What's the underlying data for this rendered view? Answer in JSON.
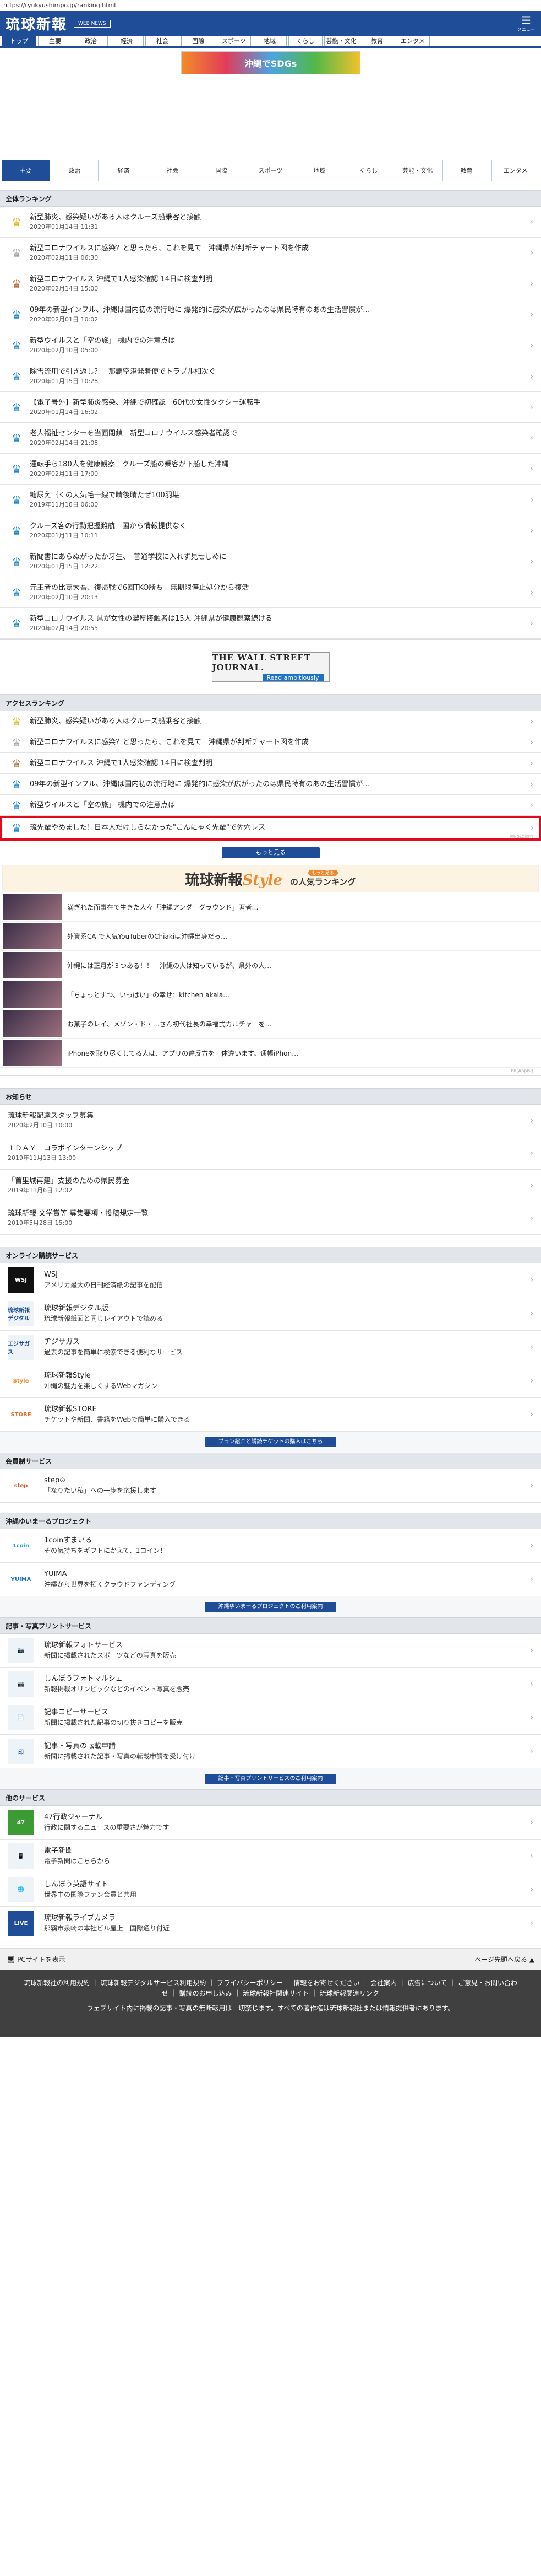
{
  "url": "https://ryukyushimpo.jp/ranking.html",
  "site": {
    "logo": "琉球新報",
    "web_news": "WEB NEWS",
    "menu": "メニュー"
  },
  "top_nav": [
    "トップ",
    "主要",
    "政治",
    "経済",
    "社会",
    "国際",
    "スポーツ",
    "地域",
    "くらし",
    "芸能・文化",
    "教育",
    "エンタメ"
  ],
  "banner_text": "沖縄でSDGs",
  "tabs": [
    "主要",
    "政治",
    "経済",
    "社会",
    "国際",
    "スポーツ",
    "地域",
    "くらし",
    "芸能・文化",
    "教育",
    "エンタメ"
  ],
  "overall": {
    "heading": "全体ランキング",
    "items": [
      {
        "title": "新型肺炎、感染疑いがある人はクルーズ船乗客と接触",
        "date": "2020年01月14日 11:31",
        "crown": "g"
      },
      {
        "title": "新型コロナウイルスに感染？と思ったら、これを見て　沖縄県が判断チャート図を作成",
        "date": "2020年02月11日 06:30",
        "crown": "s"
      },
      {
        "title": "新型コロナウイルス 沖縄で1人感染確認 14日に検査判明",
        "date": "2020年02月14日 15:00",
        "crown": "bz"
      },
      {
        "title": "09年の新型インフル、沖縄は国内初の流行地に 爆発的に感染が広がったのは県民特有のあの生活習慣が…",
        "date": "2020年02月01日 10:02",
        "crown": "bl"
      },
      {
        "title": "新型ウイルスと「空の旅」 機内での注意点は",
        "date": "2020年02月10日 05:00",
        "crown": "bl"
      },
      {
        "title": "除雪流用で引き返し？　那覇空港発着便でトラブル相次ぐ",
        "date": "2020年01月15日 10:28",
        "crown": "bl"
      },
      {
        "title": "【電子号外】新型肺炎感染、沖縄で初確認　60代の女性タクシー運転手",
        "date": "2020年01月14日 16:02",
        "crown": "bl"
      },
      {
        "title": "老人福祉センターを当面閉鎖　新型コロナウイルス感染者確認で",
        "date": "2020年02月14日 21:08",
        "crown": "bl"
      },
      {
        "title": "運転手ら180人を健康観察　クルーズ船の乗客が下船した沖縄",
        "date": "2020年02月11日 17:00",
        "crown": "bl"
      },
      {
        "title": "糖尿え｛くの天気毛一線で晴後晴たぜ100羽堪",
        "date": "2019年11月18日 06:00",
        "crown": "bl"
      },
      {
        "title": "クルーズ客の行動把握難航　国から情報提供なく",
        "date": "2020年01月11日 10:11",
        "crown": "bl"
      },
      {
        "title": "新聞書にあらぬがったか牙生、　普通学校に入れず見せしめに",
        "date": "2020年01月15日 12:22",
        "crown": "bl"
      },
      {
        "title": "元王者の比嘉大吾、復帰戦で6回TKO勝ち　無期限停止処分から復活",
        "date": "2020年02月10日 20:13",
        "crown": "bl"
      },
      {
        "title": "新型コロナウイルス 県が女性の濃厚接触者は15人 沖縄県が健康観察続ける",
        "date": "2020年02月14日 20:55",
        "crown": "bl"
      }
    ]
  },
  "ad": {
    "line1": "THE WALL STREET JOURNAL.",
    "line2": "Read ambitiously"
  },
  "access": {
    "heading": "アクセスランキング",
    "items": [
      {
        "title": "新型肺炎、感染疑いがある人はクルーズ船乗客と接触",
        "crown": "g"
      },
      {
        "title": "新型コロナウイルスに感染？と思ったら、これを見て　沖縄県が判断チャート図を作成",
        "crown": "s"
      },
      {
        "title": "新型コロナウイルス 沖縄で1人感染確認 14日に検査判明",
        "crown": "bz"
      },
      {
        "title": "09年の新型インフル、沖縄は国内初の流行地に 爆発的に感染が広がったのは県民特有のあの生活習慣が…",
        "crown": "bl"
      },
      {
        "title": "新型ウイルスと「空の旅」 機内での注意点は",
        "crown": "bl"
      }
    ],
    "promo": {
      "title": "琉先輩やめました！日本人だけしらなかった\"こんにゃく先輩\"で佐穴レス",
      "pr": "PR(GLOSSY)"
    },
    "more": "もっと見る"
  },
  "style_ranking": {
    "logo_a": "琉球新報",
    "logo_b": "Style",
    "pill": "もっと見る",
    "big": "の人気ランキング",
    "pr": "PR(Applsi)",
    "items": [
      "満ぎれた而事在で生きた人々「沖縄アンダーグラウンド」著者…",
      "外資系CA で人気YouTuberのChiakiは沖縄出身だっ…",
      "沖縄には正月が３つある！！　沖縄の人は知っているが、県外の人…",
      "「ちょっとずつ、いっぱい」の幸せ：kitchen akala…",
      "お菓子のレイ、メゾン・ド・…さん初代社長の幸福式カルチャーを…",
      "iPhoneを取り尽くしてる人は、アプリの違反方を一体違います。通帳iPhon…"
    ]
  },
  "news": {
    "heading": "お知らせ",
    "items": [
      {
        "title": "琉球新報配達スタッフ募集",
        "date": "2020年2月10日 10:00"
      },
      {
        "title": "１ＤＡＹ　コラボインターンシップ",
        "date": "2019年11月13日 13:00"
      },
      {
        "title": "「首里城再建」支援のための県民募金",
        "date": "2019年11月6日 12:02"
      },
      {
        "title": "琉球新報 文学賞等 募集要項・投稿規定一覧",
        "date": "2019年5月28日 15:00"
      }
    ]
  },
  "online": {
    "heading": "オンライン購読サービス",
    "items": [
      {
        "icon": "WSJ",
        "name": "WSJ",
        "desc": "アメリカ最大の日刊経済紙の記事を配信"
      },
      {
        "icon": "琉球新報デジタル",
        "name": "琉球新報デジタル版",
        "desc": "琉球新報紙面と同じレイアウトで読める"
      },
      {
        "icon": "エジサガス",
        "name": "ヂジサガス",
        "desc": "過去の記事を簡単に検索できる便利なサービス"
      },
      {
        "icon": "Style",
        "name": "琉球新報Style",
        "desc": "沖縄の魅力を楽しくするWebマガジン"
      },
      {
        "icon": "STORE",
        "name": "琉球新報STORE",
        "desc": "チケットや新聞、書籍をWebで簡単に購入できる"
      }
    ],
    "link": "プラン紹介と購読チケットの購入はこちら"
  },
  "member": {
    "heading": "会員制サービス",
    "items": [
      {
        "icon": "step",
        "name": "step⊙",
        "desc": "「なりたい私」への一歩を応援します"
      }
    ]
  },
  "project": {
    "heading": "沖縄ゆいまーるプロジェクト",
    "items": [
      {
        "icon": "1coin",
        "name": "1coinすまいる",
        "desc": "その気持ちをギフトにかえて、1コイン！"
      },
      {
        "icon": "YUIMA",
        "name": "YUIMA",
        "desc": "沖縄から世界を拓くクラウドファンディング"
      }
    ],
    "link": "沖縄ゆいまーるプロジェクトのご利用案内"
  },
  "photo": {
    "heading": "記事・写真プリントサービス",
    "items": [
      {
        "icon": "📷",
        "name": "琉球新報フォトサービス",
        "desc": "新聞に掲載されたスポーツなどの写真を販売"
      },
      {
        "icon": "📷",
        "name": "しんぽうフォトマルシェ",
        "desc": "新報掲載オリンピックなどのイベント写真を販売"
      },
      {
        "icon": "📄",
        "name": "記事コピーサービス",
        "desc": "新聞に掲載された記事の切り抜きコピーを販売"
      },
      {
        "icon": "印",
        "name": "記事・写真の転載申請",
        "desc": "新聞に掲載された記事・写真の転載申請を受け付け"
      }
    ],
    "link": "記事・写真プリントサービスのご利用案内"
  },
  "others": {
    "heading": "他のサービス",
    "items": [
      {
        "icon": "47",
        "name": "47行政ジャーナル",
        "desc": "行政に関するニュースの重要さが魅力です"
      },
      {
        "icon": "📱",
        "name": "電子新聞",
        "desc": "電子新聞はこちらから"
      },
      {
        "icon": "🌐",
        "name": "しんぽう英語サイト",
        "desc": "世界中の国際ファン会員と共用"
      },
      {
        "icon": "LIVE",
        "name": "琉球新報ライブカメラ",
        "desc": "那覇市泉崎の本社ビル屋上　国際通り付近"
      }
    ]
  },
  "pc_bar": {
    "left": "PCサイトを表示",
    "right": "ページ先頭へ戻る"
  },
  "footer": {
    "links": "琉球新報社の利用規約 ｜ 琉球新報デジタルサービス利用規約 ｜ プライバシーポリシー ｜ 情報をお寄せください ｜ 会社案内 ｜ 広告について ｜ ご意見・お問い合わせ ｜ 購読のお申し込み ｜ 琉球新報社関連サイト ｜ 琉球新報関連リンク",
    "copy": "ウェブサイト内に掲載の記事・写真の無断転用は一切禁じます。すべての著作権は琉球新報社または情報提供者にあります。"
  }
}
